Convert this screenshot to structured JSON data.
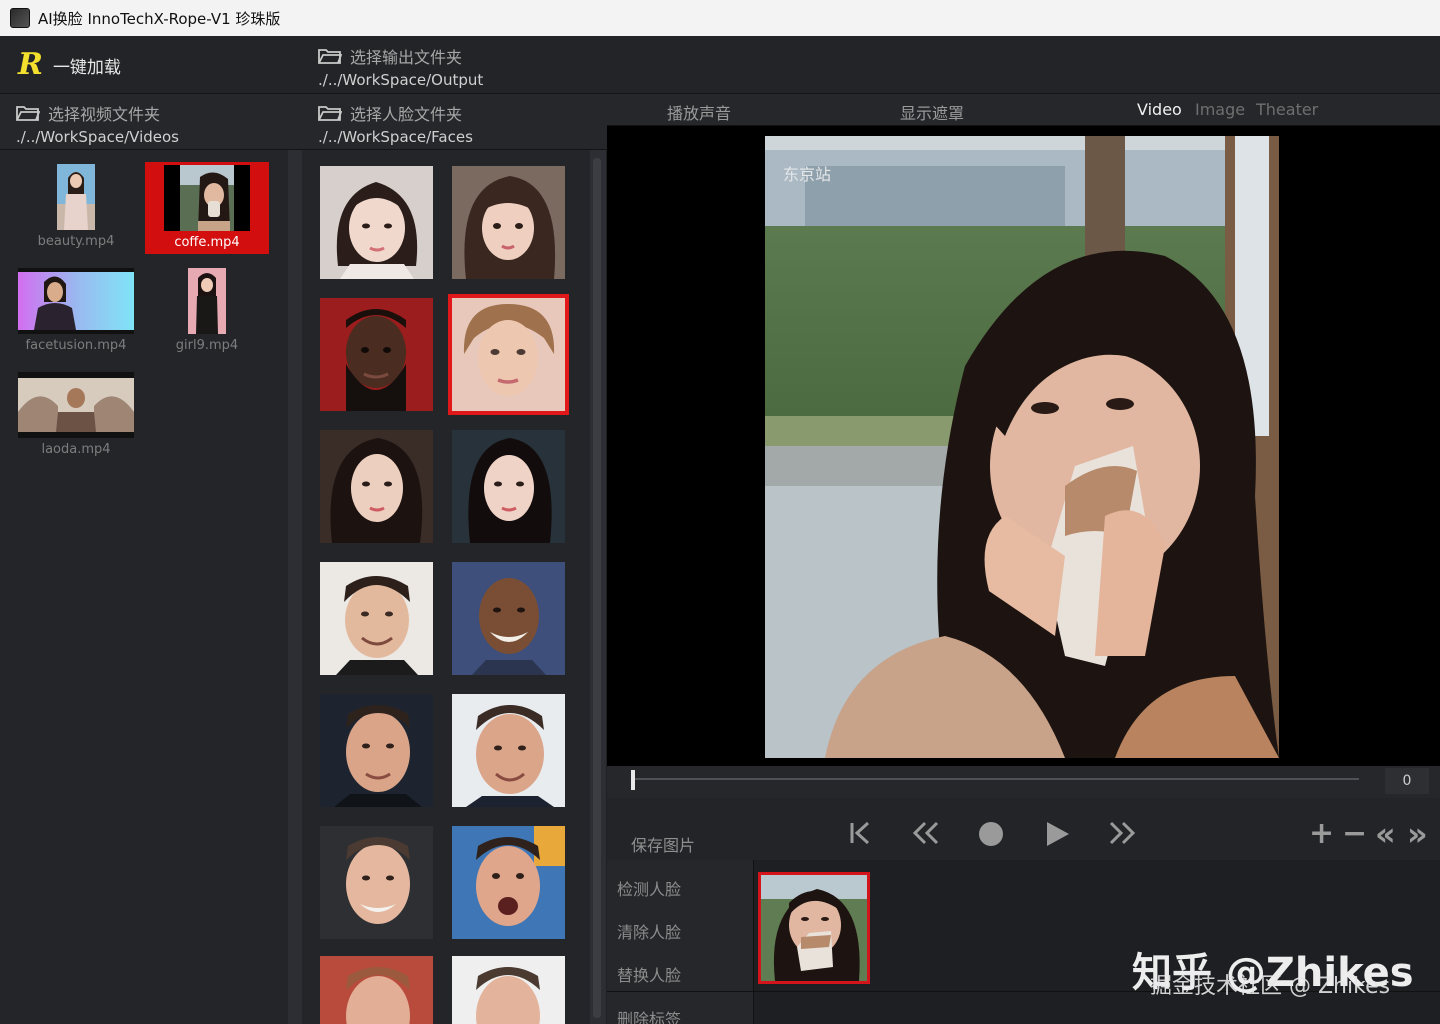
{
  "window": {
    "title": "AI换脸  InnoTechX-Rope-V1 珍珠版"
  },
  "brand": {
    "logo": "R",
    "load_label": "一键加载"
  },
  "output": {
    "label": "选择输出文件夹",
    "path": "./../WorkSpace/Output"
  },
  "videos": {
    "label": "选择视频文件夹",
    "path": "./../WorkSpace/Videos",
    "items": [
      {
        "name": "beauty.mp4"
      },
      {
        "name": "coffe.mp4",
        "selected": true
      },
      {
        "name": "facetusion.mp4"
      },
      {
        "name": "girl9.mp4"
      },
      {
        "name": "laoda.mp4"
      }
    ]
  },
  "faces": {
    "label": "选择人脸文件夹",
    "path": "./../WorkSpace/Faces",
    "count": 14,
    "selected_index": 3
  },
  "preview": {
    "play_audio": "播放声音",
    "show_mask": "显示遮罩",
    "tabs": [
      "Video",
      "Image",
      "Theater"
    ],
    "active_tab": "Video",
    "frame_caption": "东京站",
    "frame_count": "0"
  },
  "controls": {
    "save_image": "保存图片",
    "zoom_in": "+",
    "zoom_out": "−",
    "prev_marker": "«",
    "next_marker": "»"
  },
  "actions": {
    "detect": "检测人脸",
    "clear": "清除人脸",
    "swap": "替换人脸",
    "delete_tag": "删除标签"
  },
  "watermark": {
    "main": "知乎 @Zhikes",
    "sub": "掘金技术社区 @ Zhikes"
  },
  "colors": {
    "accent_red": "#d30e0e",
    "logo_yellow": "#f3e02e",
    "bg": "#1f2023"
  }
}
